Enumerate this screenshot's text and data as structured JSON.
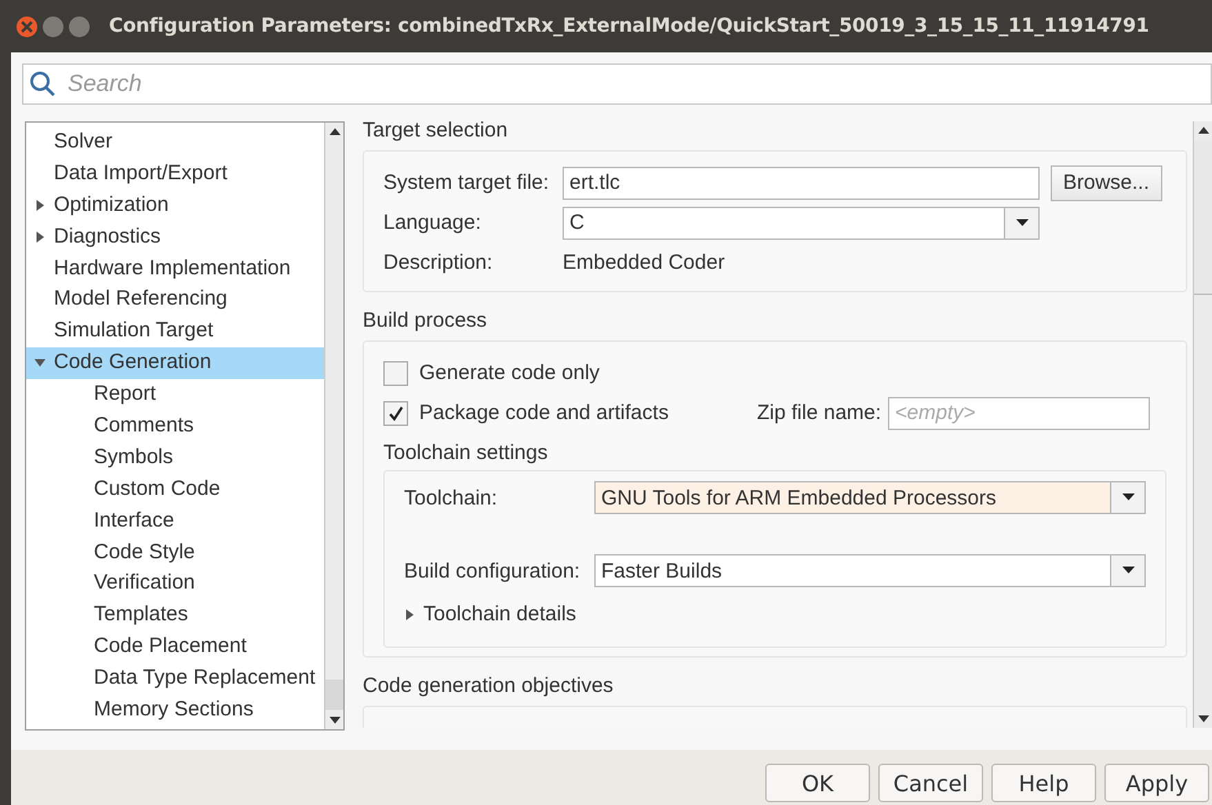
{
  "window": {
    "title": "Configuration Parameters: combinedTxRx_ExternalMode/QuickStart_50019_3_15_15_11_11914791"
  },
  "search": {
    "placeholder": "Search"
  },
  "tree": [
    {
      "label": "Solver",
      "selected": false
    },
    {
      "label": "Data Import/Export",
      "selected": false
    },
    {
      "label": "Optimization",
      "expanded": false,
      "selected": false
    },
    {
      "label": "Diagnostics",
      "expanded": false,
      "selected": false
    },
    {
      "label": "Hardware Implementation",
      "selected": false
    },
    {
      "label": "Model Referencing",
      "selected": false
    },
    {
      "label": "Simulation Target",
      "selected": false
    },
    {
      "label": "Code Generation",
      "expanded": true,
      "selected": true,
      "children": [
        {
          "label": "Report",
          "selected": false
        },
        {
          "label": "Comments",
          "selected": false
        },
        {
          "label": "Symbols",
          "selected": false
        },
        {
          "label": "Custom Code",
          "selected": false
        },
        {
          "label": "Interface",
          "selected": false
        },
        {
          "label": "Code Style",
          "selected": false
        },
        {
          "label": "Verification",
          "selected": false
        },
        {
          "label": "Templates",
          "selected": false
        },
        {
          "label": "Code Placement",
          "selected": false
        },
        {
          "label": "Data Type Replacement",
          "selected": false
        },
        {
          "label": "Memory Sections",
          "selected": false
        }
      ]
    }
  ],
  "target_selection": {
    "title": "Target selection",
    "system_target_file": {
      "label": "System target file:",
      "value": "ert.tlc",
      "button": "Browse..."
    },
    "language": {
      "label": "Language:",
      "value": "C"
    },
    "description": {
      "label": "Description:",
      "value": "Embedded Coder"
    }
  },
  "build_process": {
    "title": "Build process",
    "checkboxes": [
      {
        "label": "Generate code only",
        "checked": false
      },
      {
        "label": "Package code and artifacts",
        "checked": true
      }
    ],
    "zip_file": {
      "label": "Zip file name:",
      "placeholder": "<empty>"
    },
    "toolchain_settings": {
      "title": "Toolchain settings",
      "toolchain": {
        "label": "Toolchain:",
        "value": "GNU Tools for ARM Embedded Processors"
      },
      "build_configuration": {
        "label": "Build configuration:",
        "value": "Faster Builds"
      },
      "details": {
        "label": "Toolchain details",
        "expanded": false
      }
    }
  },
  "objectives": {
    "title": "Code generation objectives"
  },
  "buttons": [
    "OK",
    "Cancel",
    "Help",
    "Apply"
  ]
}
